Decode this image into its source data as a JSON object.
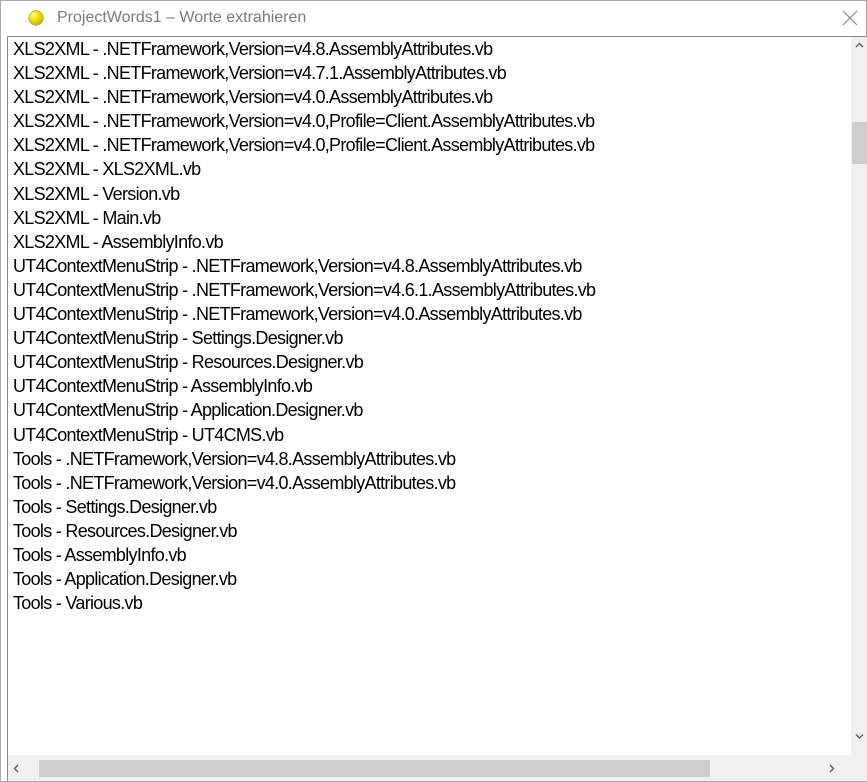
{
  "window": {
    "title": "ProjectWords1 – Worte extrahieren",
    "icon": "yellow-ball-icon",
    "accent_color": "#f5e400"
  },
  "listbox": {
    "items": [
      "XLS2XML - .NETFramework,Version=v4.8.AssemblyAttributes.vb",
      "XLS2XML - .NETFramework,Version=v4.7.1.AssemblyAttributes.vb",
      "XLS2XML - .NETFramework,Version=v4.0.AssemblyAttributes.vb",
      "XLS2XML - .NETFramework,Version=v4.0,Profile=Client.AssemblyAttributes.vb",
      "XLS2XML - .NETFramework,Version=v4.0,Profile=Client.AssemblyAttributes.vb",
      "XLS2XML - XLS2XML.vb",
      "XLS2XML - Version.vb",
      "XLS2XML - Main.vb",
      "XLS2XML - AssemblyInfo.vb",
      "UT4ContextMenuStrip - .NETFramework,Version=v4.8.AssemblyAttributes.vb",
      "UT4ContextMenuStrip - .NETFramework,Version=v4.6.1.AssemblyAttributes.vb",
      "UT4ContextMenuStrip - .NETFramework,Version=v4.0.AssemblyAttributes.vb",
      "UT4ContextMenuStrip - Settings.Designer.vb",
      "UT4ContextMenuStrip - Resources.Designer.vb",
      "UT4ContextMenuStrip - AssemblyInfo.vb",
      "UT4ContextMenuStrip - Application.Designer.vb",
      "UT4ContextMenuStrip - UT4CMS.vb",
      "Tools - .NETFramework,Version=v4.8.AssemblyAttributes.vb",
      "Tools - .NETFramework,Version=v4.0.AssemblyAttributes.vb",
      "Tools - Settings.Designer.vb",
      "Tools - Resources.Designer.vb",
      "Tools - AssemblyInfo.vb",
      "Tools - Application.Designer.vb",
      "Tools - Various.vb"
    ]
  },
  "scrollbars": {
    "vertical_position": 0.08,
    "horizontal_position": 0.0,
    "icons": {
      "up": "chevron-up-icon",
      "down": "chevron-down-icon",
      "left": "chevron-left-icon",
      "right": "chevron-right-icon"
    }
  }
}
